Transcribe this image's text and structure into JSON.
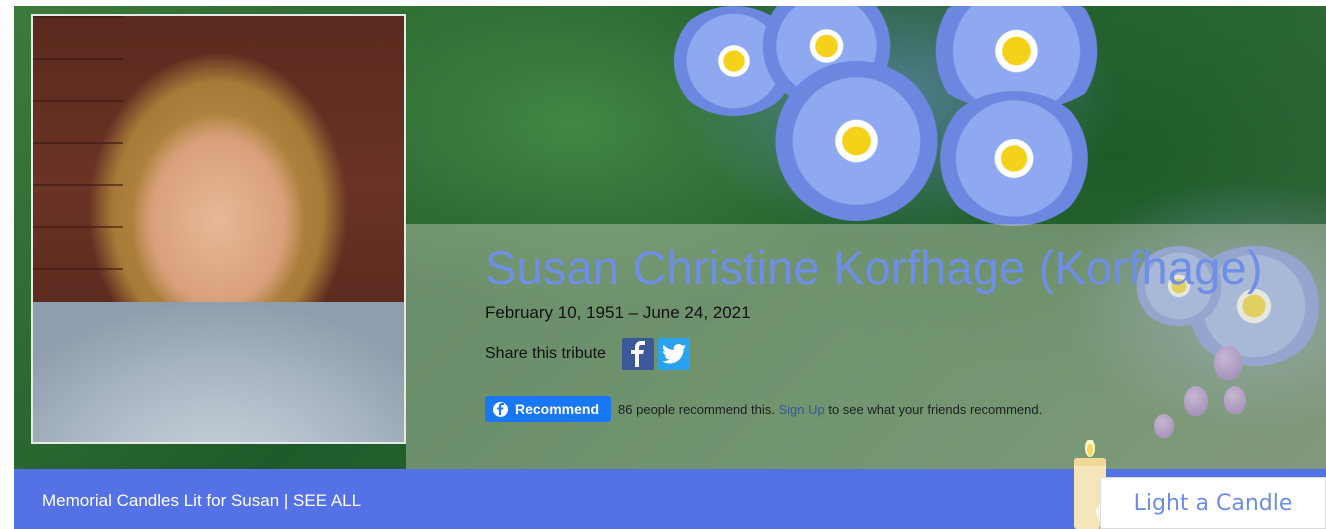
{
  "tribute": {
    "name": "Susan Christine Korfhage (Korfhage)",
    "dates": "February 10, 1951 – June 24, 2021",
    "share_label": "Share this tribute"
  },
  "social": {
    "facebook_icon": "facebook-icon",
    "twitter_icon": "twitter-icon"
  },
  "recommend": {
    "button_label": "Recommend",
    "count_text": "86 people recommend this.",
    "signup_link": "Sign Up",
    "suffix_text": "to see what your friends recommend."
  },
  "footer": {
    "candles_link": "Memorial Candles Lit for Susan | SEE ALL",
    "light_candle_button": "Light a Candle"
  },
  "colors": {
    "name_color": "#6f8ee6",
    "footer_bar": "#5571e6",
    "facebook_blue": "#1877f2"
  }
}
